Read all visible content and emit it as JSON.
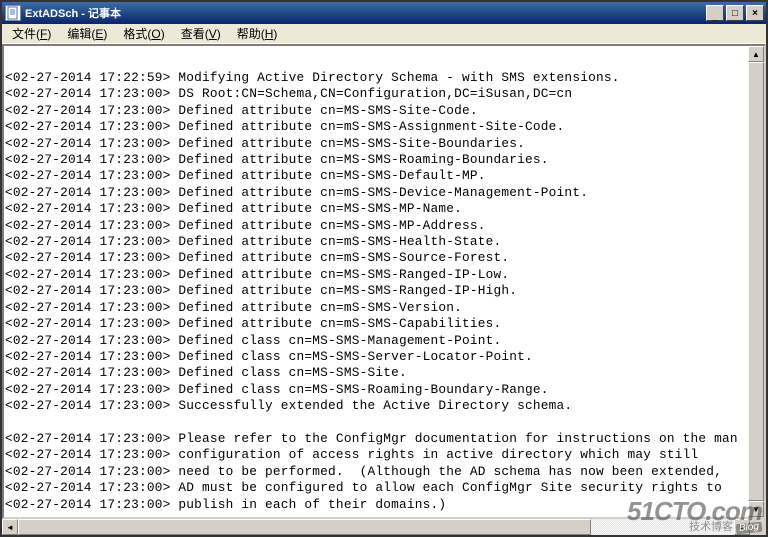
{
  "window": {
    "title": "ExtADSch - 记事本"
  },
  "menu": {
    "file": {
      "label": "文件(",
      "accel": "F",
      "suffix": ")"
    },
    "edit": {
      "label": "编辑(",
      "accel": "E",
      "suffix": ")"
    },
    "format": {
      "label": "格式(",
      "accel": "O",
      "suffix": ")"
    },
    "view": {
      "label": "查看(",
      "accel": "V",
      "suffix": ")"
    },
    "help": {
      "label": "帮助(",
      "accel": "H",
      "suffix": ")"
    }
  },
  "log": {
    "lines": [
      "<02-27-2014 17:22:59> Modifying Active Directory Schema - with SMS extensions.",
      "<02-27-2014 17:23:00> DS Root:CN=Schema,CN=Configuration,DC=iSusan,DC=cn",
      "<02-27-2014 17:23:00> Defined attribute cn=MS-SMS-Site-Code.",
      "<02-27-2014 17:23:00> Defined attribute cn=mS-SMS-Assignment-Site-Code.",
      "<02-27-2014 17:23:00> Defined attribute cn=MS-SMS-Site-Boundaries.",
      "<02-27-2014 17:23:00> Defined attribute cn=MS-SMS-Roaming-Boundaries.",
      "<02-27-2014 17:23:00> Defined attribute cn=MS-SMS-Default-MP.",
      "<02-27-2014 17:23:00> Defined attribute cn=mS-SMS-Device-Management-Point.",
      "<02-27-2014 17:23:00> Defined attribute cn=MS-SMS-MP-Name.",
      "<02-27-2014 17:23:00> Defined attribute cn=MS-SMS-MP-Address.",
      "<02-27-2014 17:23:00> Defined attribute cn=mS-SMS-Health-State.",
      "<02-27-2014 17:23:00> Defined attribute cn=mS-SMS-Source-Forest.",
      "<02-27-2014 17:23:00> Defined attribute cn=MS-SMS-Ranged-IP-Low.",
      "<02-27-2014 17:23:00> Defined attribute cn=MS-SMS-Ranged-IP-High.",
      "<02-27-2014 17:23:00> Defined attribute cn=mS-SMS-Version.",
      "<02-27-2014 17:23:00> Defined attribute cn=mS-SMS-Capabilities.",
      "<02-27-2014 17:23:00> Defined class cn=MS-SMS-Management-Point.",
      "<02-27-2014 17:23:00> Defined class cn=MS-SMS-Server-Locator-Point.",
      "<02-27-2014 17:23:00> Defined class cn=MS-SMS-Site.",
      "<02-27-2014 17:23:00> Defined class cn=MS-SMS-Roaming-Boundary-Range.",
      "<02-27-2014 17:23:00> Successfully extended the Active Directory schema.",
      "",
      "<02-27-2014 17:23:00> Please refer to the ConfigMgr documentation for instructions on the man",
      "<02-27-2014 17:23:00> configuration of access rights in active directory which may still",
      "<02-27-2014 17:23:00> need to be performed.  (Although the AD schema has now been extended,",
      "<02-27-2014 17:23:00> AD must be configured to allow each ConfigMgr Site security rights to",
      "<02-27-2014 17:23:00> publish in each of their domains.)"
    ]
  },
  "controls": {
    "minimize": "_",
    "maximize": "□",
    "close": "×",
    "up": "▲",
    "down": "▼",
    "left": "◄",
    "right": "►"
  },
  "watermark": {
    "main": "51CTO.com",
    "sub": "技术博客",
    "tag": "Blog"
  }
}
